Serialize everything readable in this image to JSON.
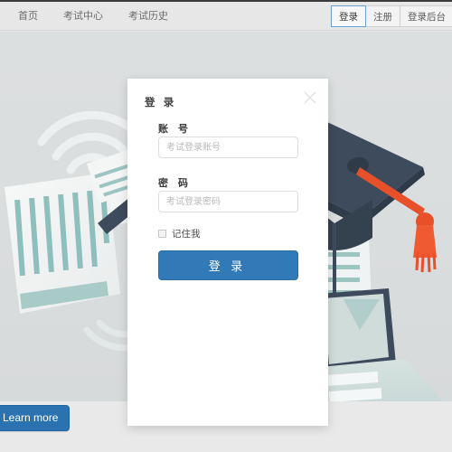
{
  "navbar": {
    "items": [
      {
        "label": "首页"
      },
      {
        "label": "考试中心"
      },
      {
        "label": "考试历史"
      }
    ],
    "buttons": [
      {
        "label": "登录",
        "active": true
      },
      {
        "label": "注册",
        "active": false
      },
      {
        "label": "登录后台",
        "active": false
      }
    ]
  },
  "hero": {
    "learn_more_label": "Learn more",
    "illustration": {
      "name": "exam-education-illustration",
      "elements": [
        "paper-document",
        "orange-pencil",
        "wifi-arcs",
        "graduation-cap",
        "red-tassel",
        "laptop"
      ],
      "colors": {
        "background": "#dcdfe0",
        "paper": "#f2f4f4",
        "teal_line": "#8fbfbc",
        "pencil_orange": "#e8502a",
        "cap_dark": "#3e4b5c",
        "cap_dark2": "#2f3b49",
        "tassel_red": "#e8502a",
        "laptop_teal": "#cfdedc"
      }
    }
  },
  "modal": {
    "title": "登 录",
    "close_icon": "close-icon",
    "fields": [
      {
        "label": "账 号",
        "placeholder": "考试登录账号",
        "value": "",
        "type": "text"
      },
      {
        "label": "密 码",
        "placeholder": "考试登录密码",
        "value": "",
        "type": "password"
      }
    ],
    "remember": {
      "label": "记住我",
      "checked": false
    },
    "submit_label": "登 录"
  },
  "colors": {
    "primary": "#3279b8",
    "navbar_bg": "#e7e7e7",
    "page_bg": "#e9e9e9",
    "hero_bg": "#dcdfe0",
    "modal_bg": "#ffffff",
    "active_border": "#6f9fd0"
  }
}
